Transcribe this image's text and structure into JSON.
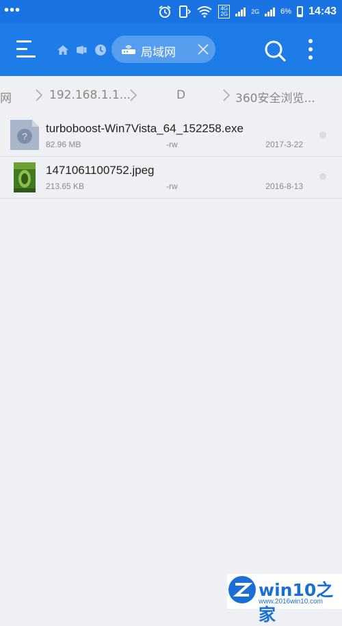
{
  "status_bar": {
    "network_top": "4G",
    "network_bottom": "2G",
    "network_2g": "2G",
    "battery": "6%",
    "time": "14:43"
  },
  "app_bar": {
    "tab_label": "局域网",
    "icons": [
      "menu-icon",
      "home-icon",
      "device-icon",
      "history-icon",
      "router-icon",
      "close-icon",
      "search-icon",
      "more-vert-icon"
    ]
  },
  "breadcrumb": [
    "网",
    "192.168.1.1...",
    "D",
    "360安全浏览..."
  ],
  "files": [
    {
      "name": "turboboost-Win7Vista_64_152258.exe",
      "size": "82.96 MB",
      "perm": "-rw",
      "date": "2017-3-22",
      "icon": "unknown-file-icon"
    },
    {
      "name": "1471061100752.jpeg",
      "size": "213.65 KB",
      "perm": "-rw",
      "date": "2016-8-13",
      "icon": "image-thumbnail"
    }
  ],
  "watermark": {
    "brand": "win10之家",
    "url": "www.2016win10.com"
  },
  "colors": {
    "status_bar": "#1a73e3",
    "app_bar": "#1e7ce8",
    "background": "#eef0f3",
    "watermark": "#1a6fd6"
  }
}
